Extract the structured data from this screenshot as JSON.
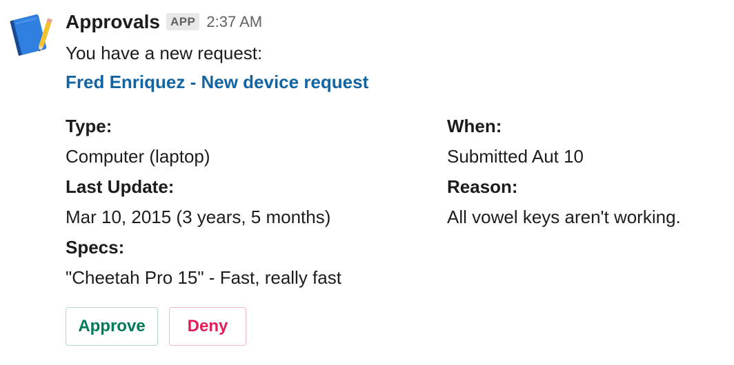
{
  "message": {
    "sender": "Approvals",
    "badge": "APP",
    "timestamp": "2:37 AM",
    "intro": "You have a new request:",
    "link_text": "Fred Enriquez - New device request",
    "avatar_icon": "notebook-pencil-icon"
  },
  "fields_left": [
    {
      "label": "Type:",
      "value": "Computer (laptop)"
    },
    {
      "label": "Last Update:",
      "value": "Mar 10, 2015 (3 years, 5 months)"
    },
    {
      "label": "Specs:",
      "value": "\"Cheetah Pro 15\" - Fast, really fast"
    }
  ],
  "fields_right": [
    {
      "label": "When:",
      "value": "Submitted Aut 10"
    },
    {
      "label": "Reason:",
      "value": "All vowel keys aren't working."
    }
  ],
  "actions": {
    "approve_label": "Approve",
    "deny_label": "Deny"
  },
  "colors": {
    "link": "#1264a3",
    "approve": "#007a5a",
    "deny": "#e01e5a"
  }
}
